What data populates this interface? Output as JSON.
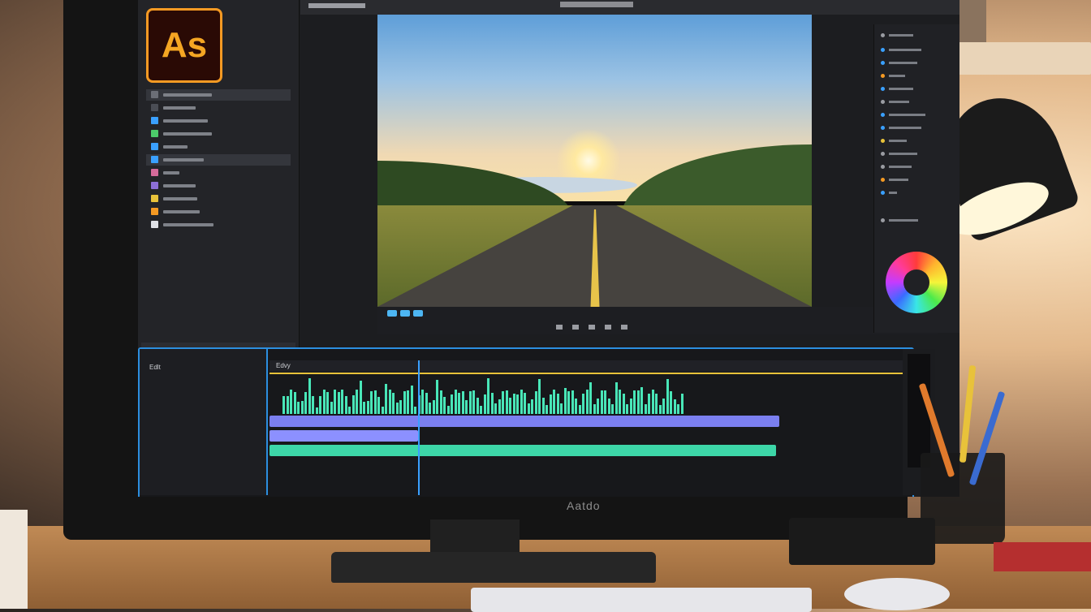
{
  "app": {
    "logo_text": "As",
    "brand_label": "Aatdo"
  },
  "colors": {
    "accent_blue": "#2c8fe0",
    "waveform_green": "#49e6b8",
    "clip_blue": "#7b7ff0",
    "marker_yellow": "#e8c23a",
    "logo_orange": "#f5a623"
  },
  "timeline": {
    "sequence_label": "Edlt",
    "ruler_label": "Edvy"
  }
}
